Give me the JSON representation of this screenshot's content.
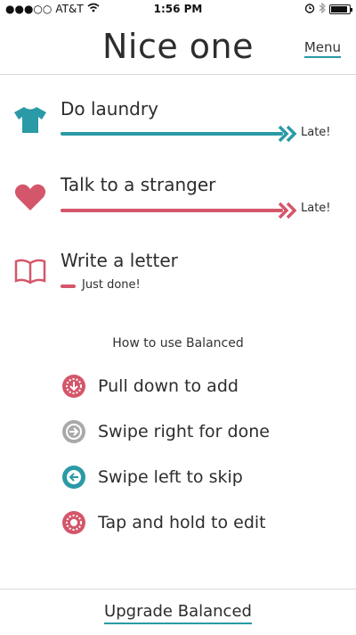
{
  "status_bar": {
    "signal": "●●●○○",
    "carrier": "AT&T",
    "time": "1:56 PM",
    "icons": [
      "wifi-icon",
      "alarm-icon",
      "bluetooth-icon",
      "battery-icon"
    ],
    "battery_level": 0.9
  },
  "header": {
    "title": "Nice one",
    "menu_label": "Menu"
  },
  "tasks": [
    {
      "title": "Do laundry",
      "icon": "tshirt-icon",
      "status": "Late!",
      "color": "#2a9aa6"
    },
    {
      "title": "Talk to a stranger",
      "icon": "heart-icon",
      "status": "Late!",
      "color": "#d4566a"
    },
    {
      "title": "Write a letter",
      "icon": "book-icon",
      "status": "Just done!",
      "color": "#d4566a"
    }
  ],
  "howto": {
    "title": "How to use Balanced",
    "items": [
      {
        "label": "Pull down to add",
        "icon": "arrow-down-icon",
        "color": "#d4566a"
      },
      {
        "label": "Swipe right for done",
        "icon": "arrow-right-icon",
        "color": "#a9a9a9"
      },
      {
        "label": "Swipe left to skip",
        "icon": "arrow-left-icon",
        "color": "#2a9aa6"
      },
      {
        "label": "Tap and hold to edit",
        "icon": "dot-icon",
        "color": "#d4566a"
      }
    ]
  },
  "footer": {
    "upgrade_label": "Upgrade Balanced"
  },
  "colors": {
    "accent_teal": "#2a9aa6",
    "accent_red": "#d4566a",
    "neutral_gray": "#a9a9a9"
  }
}
